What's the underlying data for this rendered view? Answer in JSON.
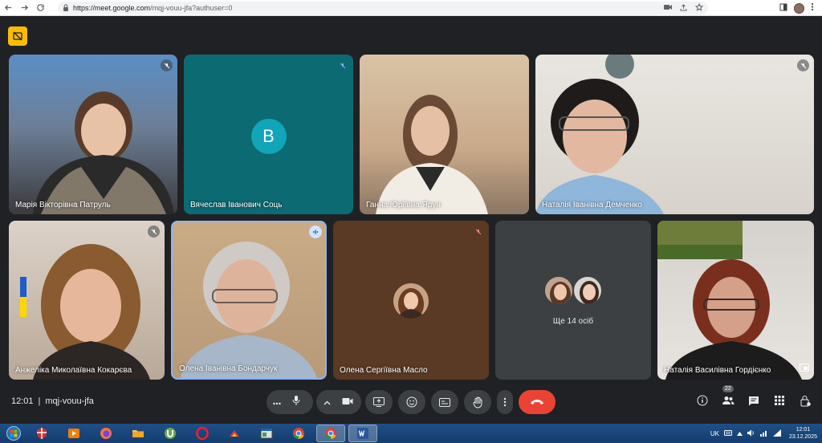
{
  "browser": {
    "url_host": "https://meet.google.com",
    "url_path": "/mqj-vouu-jfa?authuser=0"
  },
  "participants": [
    {
      "name": "Марія Вікторівна Патруль",
      "muted": true
    },
    {
      "name": "Вячеслав Іванович Соць",
      "initial": "B",
      "muted": true
    },
    {
      "name": "Ганна Юріївна Ярун",
      "muted": false
    },
    {
      "name": "Наталія Іванівна Демченко",
      "muted": true
    },
    {
      "name": "Анжеліка Миколаївна Кокарєва",
      "muted": true
    },
    {
      "name": "Олена Іванівна Бондарчук",
      "speaking": true
    },
    {
      "name": "Олена Сергіївна Масло",
      "muted": true
    },
    {
      "name": "Наталія Василівна Гордієнко",
      "muted": false
    }
  ],
  "others": {
    "label": "Ще 14 осіб"
  },
  "meeting": {
    "time": "12:01",
    "separator": "|",
    "code": "mqj-vouu-jfa",
    "participant_count": "22"
  },
  "taskbar": {
    "lang": "UK",
    "clock_time": "12:01",
    "clock_date": "23.12.2025"
  },
  "colors": {
    "background": "#202124",
    "control": "#3c4043",
    "hangup": "#ea4335",
    "accent": "#fbbc04",
    "initial_bg": "#12a4b8"
  }
}
